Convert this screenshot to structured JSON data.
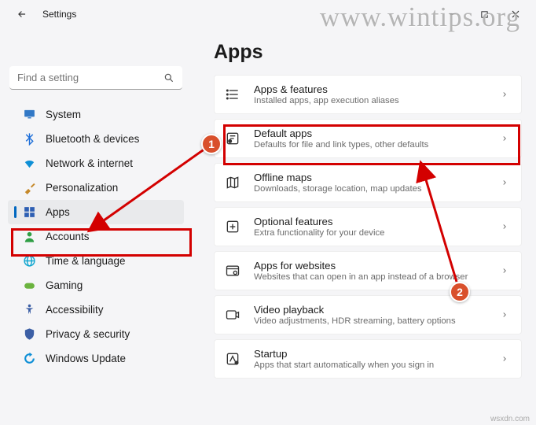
{
  "window": {
    "back_aria": "Back",
    "title": "Settings",
    "minimize_aria": "Minimize",
    "maximize_aria": "Maximize",
    "close_aria": "Close"
  },
  "search": {
    "placeholder": "Find a setting"
  },
  "sidebar": {
    "items": [
      {
        "icon": "display",
        "color": "#3178c6",
        "label": "System"
      },
      {
        "icon": "bluetooth",
        "color": "#1e6fd9",
        "label": "Bluetooth & devices"
      },
      {
        "icon": "wifi",
        "color": "#0e8fd6",
        "label": "Network & internet"
      },
      {
        "icon": "brush",
        "color": "#c58829",
        "label": "Personalization"
      },
      {
        "icon": "apps",
        "color": "#2e5fb3",
        "label": "Apps"
      },
      {
        "icon": "person",
        "color": "#2f9e44",
        "label": "Accounts"
      },
      {
        "icon": "globe",
        "color": "#0ea5cf",
        "label": "Time & language"
      },
      {
        "icon": "gamepad",
        "color": "#6bb33f",
        "label": "Gaming"
      },
      {
        "icon": "accessibility",
        "color": "#3c5fa5",
        "label": "Accessibility"
      },
      {
        "icon": "shield",
        "color": "#3c5fa5",
        "label": "Privacy & security"
      },
      {
        "icon": "update",
        "color": "#0e8fd6",
        "label": "Windows Update"
      }
    ],
    "selected_index": 4
  },
  "page": {
    "heading": "Apps"
  },
  "settings": [
    {
      "icon": "list",
      "title": "Apps & features",
      "desc": "Installed apps, app execution aliases"
    },
    {
      "icon": "default",
      "title": "Default apps",
      "desc": "Defaults for file and link types, other defaults"
    },
    {
      "icon": "map",
      "title": "Offline maps",
      "desc": "Downloads, storage location, map updates"
    },
    {
      "icon": "optional",
      "title": "Optional features",
      "desc": "Extra functionality for your device"
    },
    {
      "icon": "web",
      "title": "Apps for websites",
      "desc": "Websites that can open in an app instead of a browser"
    },
    {
      "icon": "video",
      "title": "Video playback",
      "desc": "Video adjustments, HDR streaming, battery options"
    },
    {
      "icon": "startup",
      "title": "Startup",
      "desc": "Apps that start automatically when you sign in"
    }
  ],
  "annotations": {
    "callout1": "1",
    "callout2": "2",
    "watermark": "www.wintips.org",
    "source": "wsxdn.com"
  }
}
